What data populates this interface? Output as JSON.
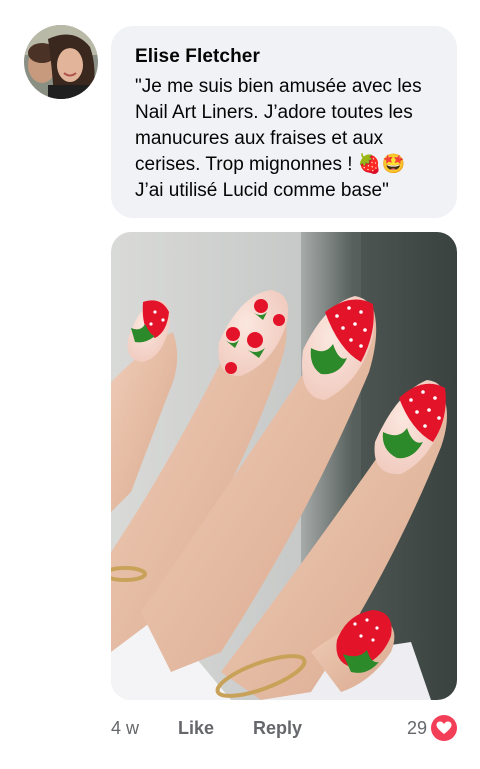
{
  "comment": {
    "author": "Elise Fletcher",
    "text": "\"Je me suis bien amusée avec les\nNail Art Liners. J’adore toutes les\nmanucures aux fraises et aux\ncerises. Trop mignonnes ! 🍓🤩\nJ’ai utilisé Lucid comme base\"",
    "avatar_icon": "profile-photo",
    "photo_icon": "strawberry-nail-art-photo"
  },
  "actions": {
    "timestamp": "4 w",
    "like_label": "Like",
    "reply_label": "Reply",
    "reaction_count": "29",
    "reaction_icon": "heart-icon"
  },
  "colors": {
    "bubble": "#f0f2f5",
    "secondary_text": "#65676b",
    "heart": "#f33e58",
    "strawberry_red": "#e3142a",
    "leaf_green": "#2c8a2a"
  }
}
